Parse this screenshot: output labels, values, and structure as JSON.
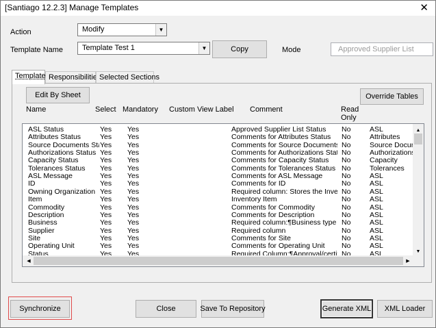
{
  "window": {
    "title": "[Santiago 12.2.3] Manage Templates"
  },
  "icons": {
    "close": "close-icon",
    "dropdown": "chevron-down-icon",
    "scroll_up": "arrow-up-icon",
    "scroll_down": "arrow-down-icon",
    "scroll_left": "arrow-left-icon",
    "scroll_right": "arrow-right-icon"
  },
  "form": {
    "action_label": "Action",
    "action_value": "Modify",
    "template_name_label": "Template Name",
    "template_name_value": "Template Test 1",
    "copy_label": "Copy",
    "mode_label": "Mode",
    "mode_value": "Approved Supplier List"
  },
  "tabs": [
    {
      "label": "Template",
      "active": true
    },
    {
      "label": "Responsibilities",
      "active": false
    },
    {
      "label": "Selected Sections",
      "active": false
    }
  ],
  "panel": {
    "edit_by_sheet_label": "Edit By Sheet",
    "override_tables_label": "Override Tables"
  },
  "grid": {
    "columns": [
      "Name",
      "Select",
      "Mandatory",
      "Custom View Label",
      "Comment",
      "Read Only"
    ],
    "rows": [
      [
        "ASL Status",
        "Yes",
        "Yes",
        "",
        "Approved Supplier List Status",
        "No",
        "ASL"
      ],
      [
        "Attributes Status",
        "Yes",
        "Yes",
        "",
        "Comments for Attributes Status",
        "No",
        "Attributes"
      ],
      [
        "Source Documents Stat",
        "Yes",
        "Yes",
        "",
        "Comments for Source Documents Sta",
        "No",
        "Source Docume"
      ],
      [
        "Authorizations Status",
        "Yes",
        "Yes",
        "",
        "Comments for Authorizations Status",
        "No",
        "Authorizations"
      ],
      [
        "Capacity Status",
        "Yes",
        "Yes",
        "",
        "Comments for Capacity Status",
        "No",
        "Capacity"
      ],
      [
        "Tolerances Status",
        "Yes",
        "Yes",
        "",
        "Comments for Tolerances Status",
        "No",
        "Tolerances"
      ],
      [
        "ASL Message",
        "Yes",
        "Yes",
        "",
        "Comments for ASL Message",
        "No",
        "ASL"
      ],
      [
        "ID",
        "Yes",
        "Yes",
        "",
        "Comments for ID",
        "No",
        "ASL"
      ],
      [
        "Owning Organization",
        "Yes",
        "Yes",
        "",
        "Required column:  Stores the Invento",
        "No",
        "ASL"
      ],
      [
        "Item",
        "Yes",
        "Yes",
        "",
        "Inventory Item",
        "No",
        "ASL"
      ],
      [
        "Commodity",
        "Yes",
        "Yes",
        "",
        "Comments for Commodity",
        "No",
        "ASL"
      ],
      [
        "Description",
        "Yes",
        "Yes",
        "",
        "Comments for Description",
        "No",
        "ASL"
      ],
      [
        "Business",
        "Yes",
        "Yes",
        "",
        "Required column:¶Business type of D",
        "No",
        "ASL"
      ],
      [
        "Supplier",
        "Yes",
        "Yes",
        "",
        "Required column",
        "No",
        "ASL"
      ],
      [
        "Site",
        "Yes",
        "Yes",
        "",
        "Comments for Site",
        "No",
        "ASL"
      ],
      [
        "Operating Unit",
        "Yes",
        "Yes",
        "",
        "Comments for Operating Unit",
        "No",
        "ASL"
      ],
      [
        "Status",
        "Yes",
        "Yes",
        "",
        "Required Column:¶Approval/certifica",
        "No",
        "ASL"
      ]
    ]
  },
  "footer": {
    "synchronize_label": "Synchronize",
    "close_label": "Close",
    "save_label": "Save To Repository",
    "generate_label": "Generate XML",
    "xml_loader_label": "XML Loader"
  },
  "colors": {
    "highlight": "#e04a4a",
    "mode_text": "#9a9a9a"
  }
}
